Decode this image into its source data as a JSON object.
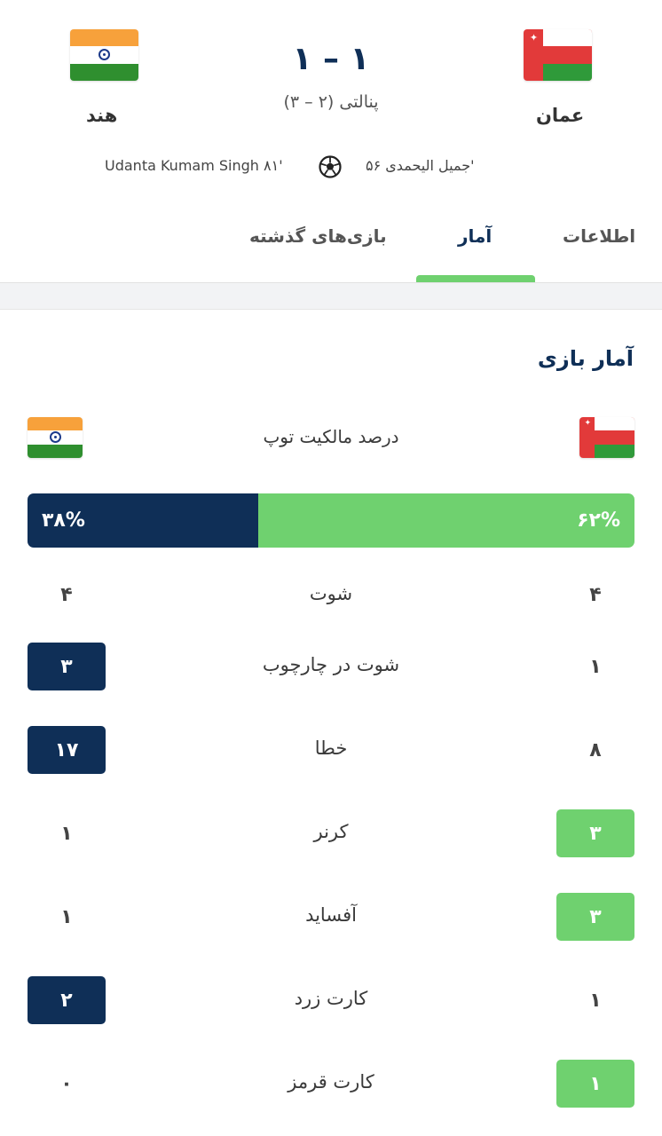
{
  "header": {
    "home_team": "عمان",
    "away_team": "هند",
    "score": "۱ – ۱",
    "penalty": "پنالتی (۲ – ۳)",
    "home_scorer": "جمیل الیحمدی ۵۶'",
    "away_scorer": "Udanta Kumam Singh ۸۱'"
  },
  "tabs": [
    {
      "label": "اطلاعات"
    },
    {
      "label": "آمار"
    },
    {
      "label": "بازی‌های گذشته"
    }
  ],
  "stats_section": {
    "title": "آمار بازی",
    "possession_label": "درصد مالکیت توپ",
    "possession_home": "۶۲%",
    "possession_away": "۳۸%",
    "possession_home_fraction": 0.62,
    "rows": [
      {
        "label": "شوت",
        "home": "۴",
        "away": "۴"
      },
      {
        "label": "شوت در چارچوب",
        "home": "۱",
        "away": "۳"
      },
      {
        "label": "خطا",
        "home": "۸",
        "away": "۱۷"
      },
      {
        "label": "کرنر",
        "home": "۳",
        "away": "۱"
      },
      {
        "label": "آفساید",
        "home": "۳",
        "away": "۱"
      },
      {
        "label": "کارت زرد",
        "home": "۱",
        "away": "۲"
      },
      {
        "label": "کارت قرمز",
        "home": "۱",
        "away": "۰"
      }
    ]
  },
  "colors": {
    "home_accent": "#6fd16f",
    "away_accent": "#0f2f57"
  }
}
